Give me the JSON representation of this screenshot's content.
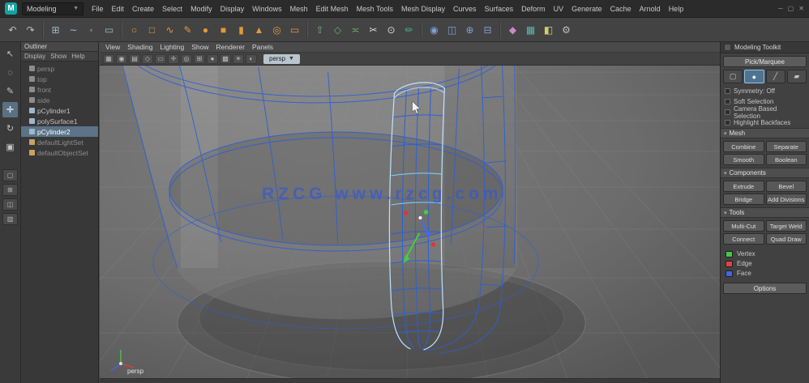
{
  "colors": {
    "accent_orange": "#e09a3c",
    "selection_blue": "#5b7287",
    "wireframe_blue": "#2e5fd3",
    "highlight_cyan": "#bfe3ff",
    "manip_red": "#e03535",
    "manip_green": "#3fd13f",
    "manip_blue": "#3f6aff",
    "viewport_gray": "#6e6e6e"
  },
  "menubar": {
    "menu_set": "Modeling",
    "menus": [
      "File",
      "Edit",
      "Create",
      "Select",
      "Modify",
      "Display",
      "Windows",
      "Mesh",
      "Edit Mesh",
      "Mesh Tools",
      "Mesh Display",
      "Curves",
      "Surfaces",
      "Deform",
      "UV",
      "Generate",
      "Cache",
      "Arnold",
      "Help"
    ]
  },
  "shelf": {
    "icons": [
      {
        "name": "undo-icon",
        "glyph": "↶",
        "color": "#bdbdbd"
      },
      {
        "name": "redo-icon",
        "glyph": "↷",
        "color": "#bdbdbd"
      },
      {
        "divider": true
      },
      {
        "name": "snap-grid-icon",
        "glyph": "⊞",
        "color": "#9fb6c8"
      },
      {
        "name": "snap-curve-icon",
        "glyph": "∼",
        "color": "#9fb6c8"
      },
      {
        "name": "snap-point-icon",
        "glyph": "◦",
        "color": "#9fb6c8"
      },
      {
        "name": "snap-plane-icon",
        "glyph": "▭",
        "color": "#9fb6c8"
      },
      {
        "divider": true
      },
      {
        "name": "nurbs-circle-icon",
        "glyph": "○",
        "color": "#e09a3c"
      },
      {
        "name": "nurbs-square-icon",
        "glyph": "□",
        "color": "#e09a3c"
      },
      {
        "name": "ep-curve-icon",
        "glyph": "∿",
        "color": "#e09a3c"
      },
      {
        "name": "pencil-curve-icon",
        "glyph": "✎",
        "color": "#e09a3c"
      },
      {
        "name": "poly-sphere-icon",
        "glyph": "●",
        "color": "#e09a3c"
      },
      {
        "name": "poly-cube-icon",
        "glyph": "■",
        "color": "#e09a3c"
      },
      {
        "name": "poly-cylinder-icon",
        "glyph": "▮",
        "color": "#e09a3c"
      },
      {
        "name": "poly-cone-icon",
        "glyph": "▲",
        "color": "#e09a3c"
      },
      {
        "name": "poly-torus-icon",
        "glyph": "◎",
        "color": "#e09a3c"
      },
      {
        "name": "poly-plane-icon",
        "glyph": "▭",
        "color": "#e09a3c"
      },
      {
        "divider": true
      },
      {
        "name": "extrude-icon",
        "glyph": "⇧",
        "color": "#6fae6f"
      },
      {
        "name": "bevel-icon",
        "glyph": "◇",
        "color": "#6fae6f"
      },
      {
        "name": "bridge-icon",
        "glyph": "≍",
        "color": "#6fae6f"
      },
      {
        "name": "multi-cut-icon",
        "glyph": "✂",
        "color": "#d9d9d9"
      },
      {
        "name": "target-weld-icon",
        "glyph": "⊙",
        "color": "#d9d9d9"
      },
      {
        "name": "quad-draw-icon",
        "glyph": "✏",
        "color": "#4fae8f"
      },
      {
        "divider": true
      },
      {
        "name": "smooth-icon",
        "glyph": "◉",
        "color": "#7f9fd8"
      },
      {
        "name": "mirror-icon",
        "glyph": "◫",
        "color": "#7f9fd8"
      },
      {
        "name": "boolean-icon",
        "glyph": "⊕",
        "color": "#7f9fd8"
      },
      {
        "name": "separate-icon",
        "glyph": "⊟",
        "color": "#7f9fd8"
      },
      {
        "divider": true
      },
      {
        "name": "sculpt-icon",
        "glyph": "◆",
        "color": "#c98ac9"
      },
      {
        "name": "uv-editor-icon",
        "glyph": "▦",
        "color": "#5fb8b8"
      },
      {
        "name": "render-icon",
        "glyph": "◧",
        "color": "#cfcf6f"
      },
      {
        "name": "render-settings-icon",
        "glyph": "⚙",
        "color": "#bdbdbd"
      }
    ]
  },
  "toolbox": {
    "tools": [
      {
        "name": "select-tool",
        "glyph": "↖"
      },
      {
        "name": "lasso-tool",
        "glyph": "◌"
      },
      {
        "name": "paint-select-tool",
        "glyph": "✎"
      },
      {
        "name": "move-tool",
        "glyph": "✛",
        "active": true
      },
      {
        "name": "rotate-tool",
        "glyph": "↻"
      },
      {
        "name": "scale-tool",
        "glyph": "▣"
      }
    ],
    "layouts": [
      {
        "name": "layout-single-pane",
        "glyph": "▢"
      },
      {
        "name": "layout-four-pane",
        "glyph": "⊞"
      },
      {
        "name": "layout-two-pane",
        "glyph": "◫"
      },
      {
        "name": "layout-outliner-persp",
        "glyph": "▥"
      }
    ]
  },
  "outliner": {
    "title": "Outliner",
    "menus": [
      "Display",
      "Show",
      "Help"
    ],
    "items": [
      {
        "label": "persp",
        "color": "#8c8c8c",
        "muted": true
      },
      {
        "label": "top",
        "color": "#8c8c8c",
        "muted": true
      },
      {
        "label": "front",
        "color": "#8c8c8c",
        "muted": true
      },
      {
        "label": "side",
        "color": "#8c8c8c",
        "muted": true
      },
      {
        "label": "pCylinder1",
        "color": "#9db8cc"
      },
      {
        "label": "polySurface1",
        "color": "#9db8cc"
      },
      {
        "label": "pCylinder2",
        "color": "#9db8cc",
        "selected": true
      },
      {
        "label": "defaultLightSet",
        "color": "#c9a25f",
        "muted": true
      },
      {
        "label": "defaultObjectSet",
        "color": "#c9a25f",
        "muted": true
      }
    ]
  },
  "viewport": {
    "menus": [
      "View",
      "Shading",
      "Lighting",
      "Show",
      "Renderer",
      "Panels"
    ],
    "icons": [
      {
        "name": "select-camera-icon",
        "glyph": "▦"
      },
      {
        "name": "lock-camera-icon",
        "glyph": "◉"
      },
      {
        "name": "camera-attributes-icon",
        "glyph": "▤"
      },
      {
        "name": "bookmark-icon",
        "glyph": "◇"
      },
      {
        "name": "image-plane-icon",
        "glyph": "▭"
      },
      {
        "name": "2d-pan-zoom-icon",
        "glyph": "✛"
      },
      {
        "name": "oversampling-icon",
        "glyph": "◎"
      },
      {
        "name": "wireframe-mode-icon",
        "glyph": "⊞"
      },
      {
        "name": "shaded-mode-icon",
        "glyph": "●"
      },
      {
        "name": "textured-mode-icon",
        "glyph": "▩"
      },
      {
        "name": "lighting-toggle-icon",
        "glyph": "☀"
      },
      {
        "name": "xray-mode-icon",
        "glyph": "◐"
      }
    ],
    "camera_label": "persp",
    "watermark": "RZCG www.rzcg.com"
  },
  "right_panel": {
    "tab_label": "Modeling Toolkit",
    "pick_button": "Pick/Marquee",
    "modes": [
      {
        "name": "object-mode-button",
        "glyph": "▢"
      },
      {
        "name": "vertex-mode-button",
        "glyph": "●",
        "active": true
      },
      {
        "name": "edge-mode-button",
        "glyph": "╱"
      },
      {
        "name": "face-mode-button",
        "glyph": "▰"
      }
    ],
    "options": [
      {
        "label": "Symmetry: Off"
      },
      {
        "label": "Soft Selection"
      },
      {
        "label": "Camera Based Selection"
      },
      {
        "label": "Highlight Backfaces"
      }
    ],
    "section_mesh": {
      "title": "Mesh",
      "buttons": [
        {
          "label": "Combine"
        },
        {
          "label": "Separate"
        },
        {
          "label": "Smooth"
        },
        {
          "label": "Boolean"
        }
      ]
    },
    "section_components": {
      "title": "Components",
      "buttons": [
        {
          "label": "Extrude"
        },
        {
          "label": "Bevel"
        },
        {
          "label": "Bridge"
        },
        {
          "label": "Add Divisions"
        }
      ]
    },
    "section_tools": {
      "title": "Tools",
      "buttons": [
        {
          "label": "Multi-Cut"
        },
        {
          "label": "Target Weld"
        },
        {
          "label": "Connect"
        },
        {
          "label": "Quad Draw"
        }
      ]
    },
    "legend": [
      {
        "color": "#44c944",
        "label": "Vertex"
      },
      {
        "color": "#e04444",
        "label": "Edge"
      },
      {
        "color": "#4466e0",
        "label": "Face"
      }
    ],
    "options_button": "Options"
  }
}
